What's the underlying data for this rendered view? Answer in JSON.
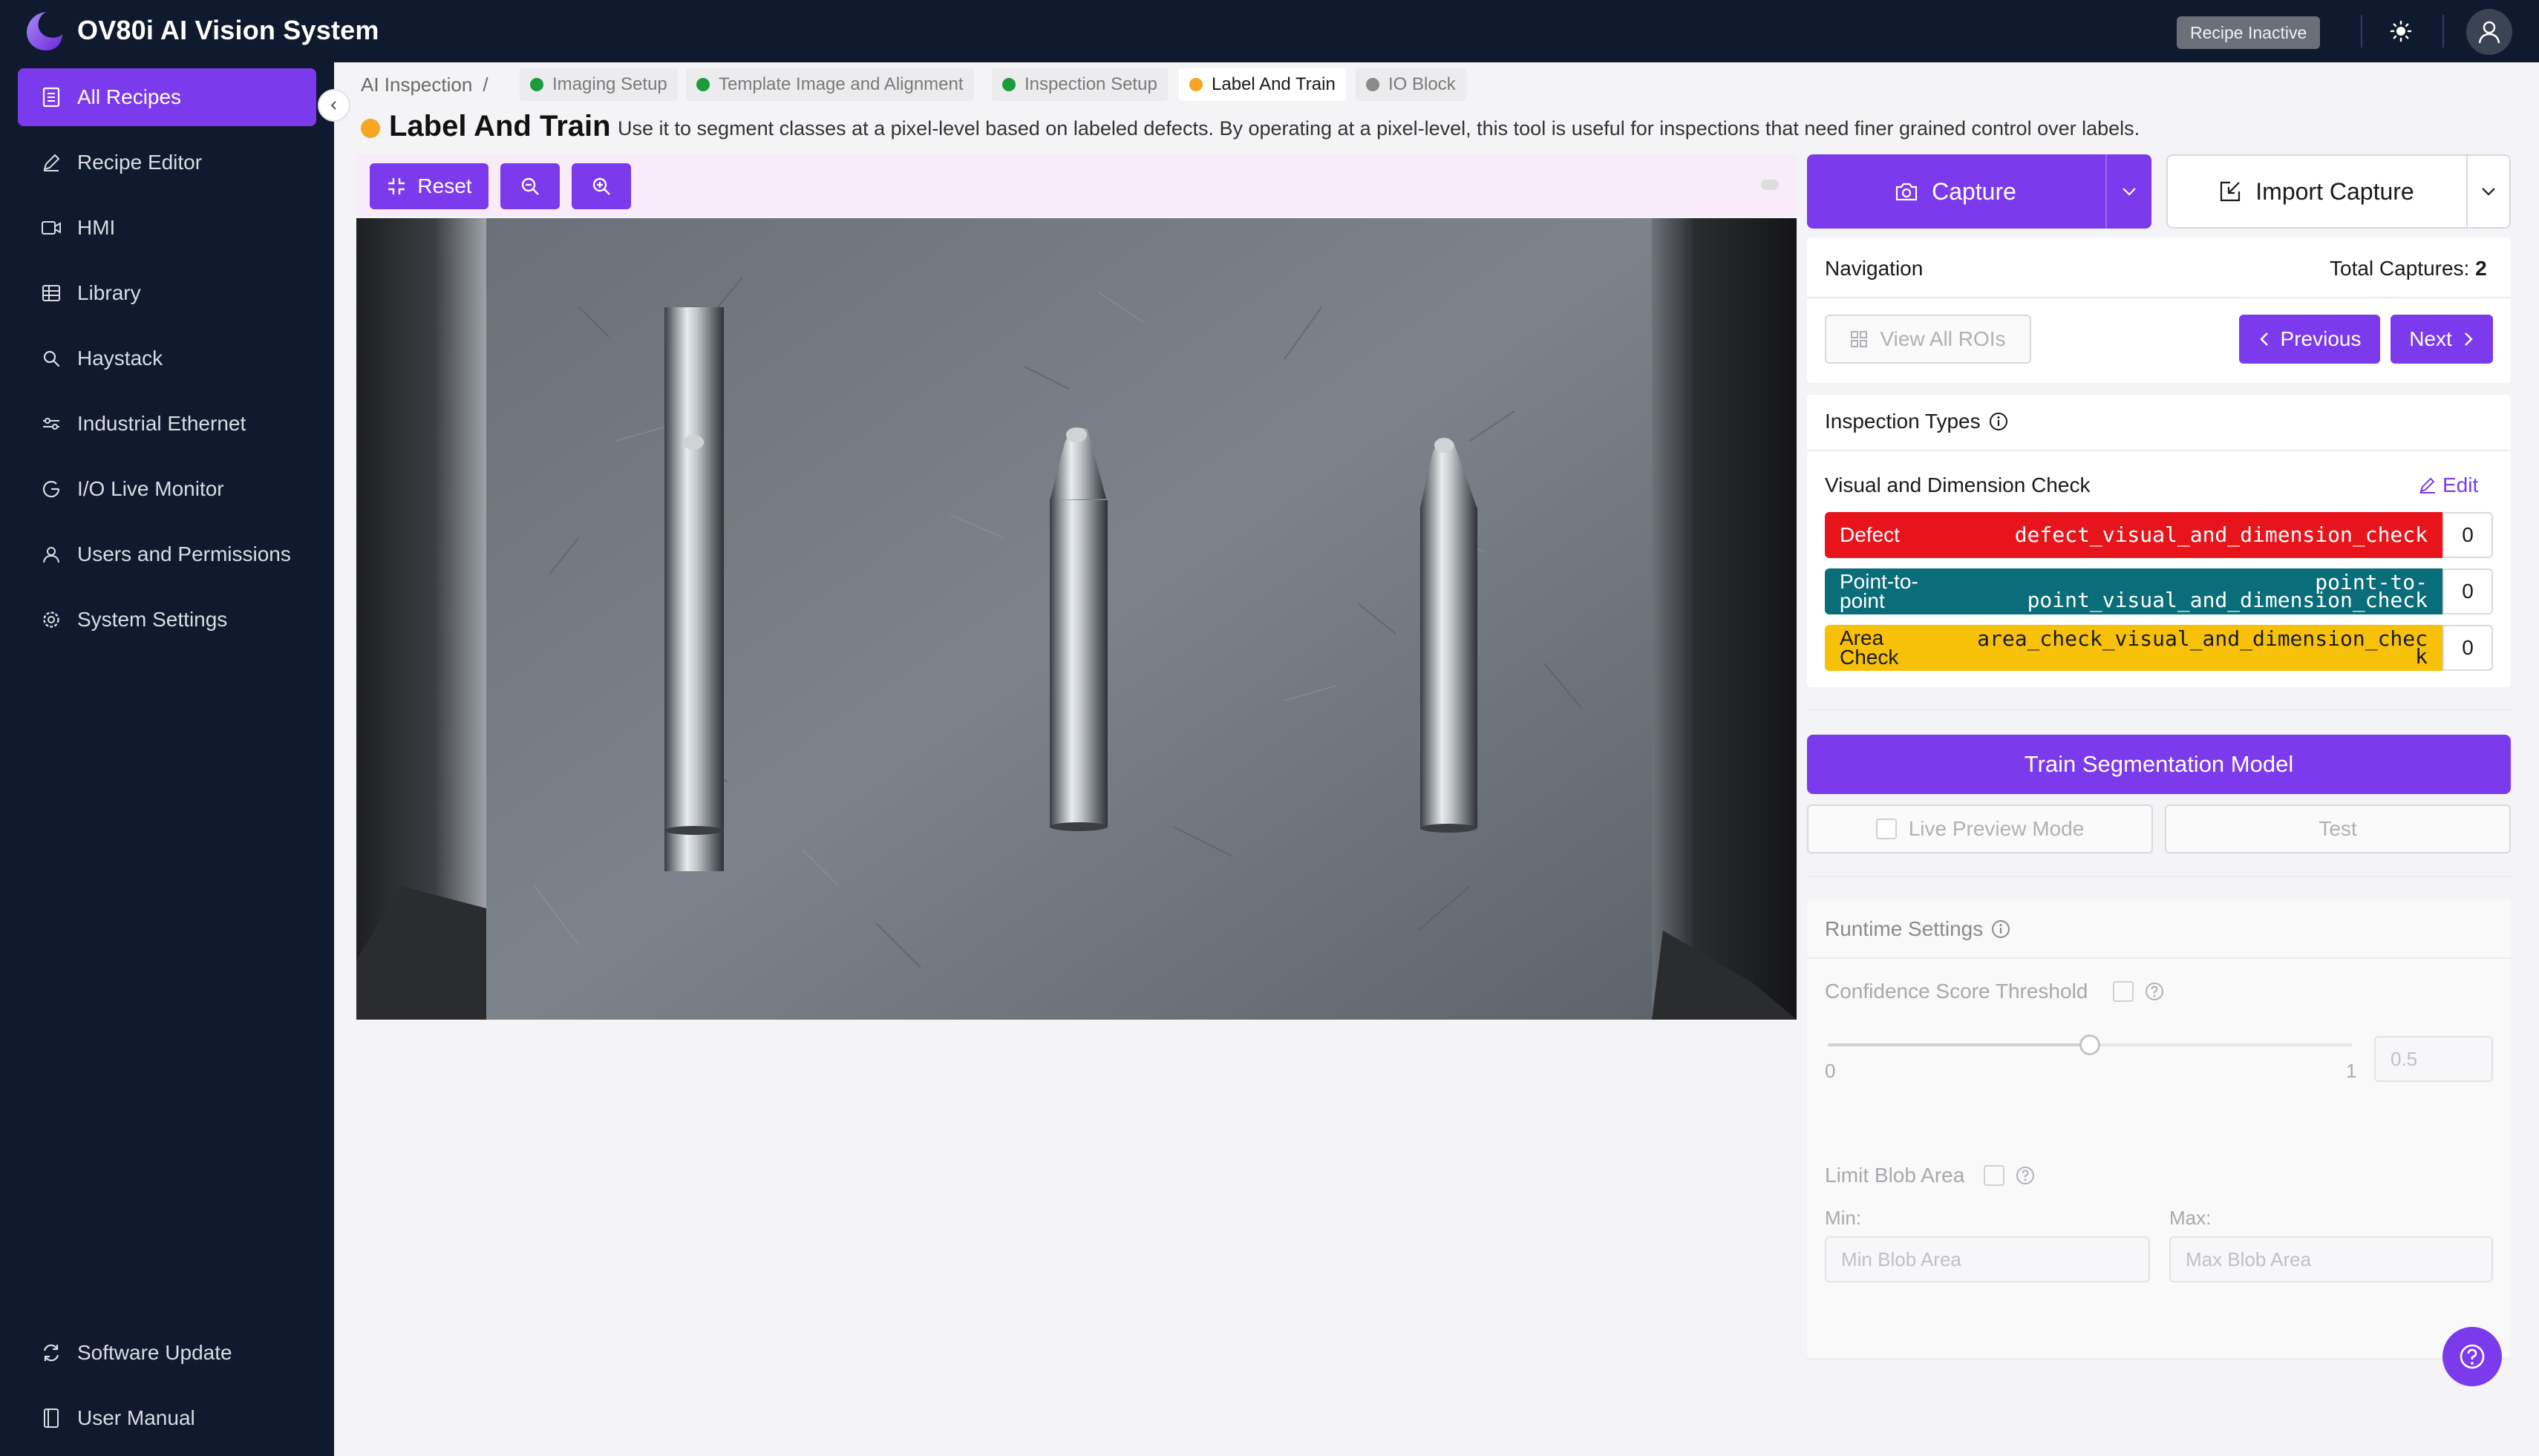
{
  "app": {
    "title": "OV80i AI Vision System",
    "recipe_status": "Recipe Inactive",
    "brand_color": "#7c3aed"
  },
  "sidebar": {
    "items": [
      {
        "label": "All Recipes",
        "icon": "document-list-icon",
        "active": true
      },
      {
        "label": "Recipe Editor",
        "icon": "pencil-icon"
      },
      {
        "label": "HMI",
        "icon": "video-icon"
      },
      {
        "label": "Library",
        "icon": "grid-icon"
      },
      {
        "label": "Haystack",
        "icon": "search-icon"
      },
      {
        "label": "Industrial Ethernet",
        "icon": "ethernet-icon"
      },
      {
        "label": "I/O Live Monitor",
        "icon": "monitor-icon"
      },
      {
        "label": "Users and Permissions",
        "icon": "user-icon"
      },
      {
        "label": "System Settings",
        "icon": "gear-icon"
      }
    ],
    "footer": [
      {
        "label": "Software Update",
        "icon": "refresh-icon"
      },
      {
        "label": "User Manual",
        "icon": "book-icon"
      }
    ]
  },
  "breadcrumb": {
    "root": "AI Inspection",
    "separator": "/",
    "steps": [
      {
        "label": "Imaging Setup",
        "color": "#1a9c3a"
      },
      {
        "label": "Template Image and Alignment",
        "color": "#1a9c3a"
      },
      {
        "label": "Inspection Setup",
        "color": "#1a9c3a"
      },
      {
        "label": "Label And Train",
        "color": "#f5a623",
        "active": true
      },
      {
        "label": "IO Block",
        "color": "#8a8a8a"
      }
    ]
  },
  "page": {
    "title": "Label And Train",
    "description": "Use it to segment classes at a pixel-level based on labeled defects. By operating at a pixel-level, this tool is useful for inspections that need finer grained control over labels."
  },
  "toolbar": {
    "reset_label": "Reset"
  },
  "capture": {
    "capture_label": "Capture",
    "import_label": "Import Capture"
  },
  "navigation": {
    "heading": "Navigation",
    "total_label": "Total Captures:",
    "total_value": "2",
    "view_all_label": "View All ROIs",
    "previous_label": "Previous",
    "next_label": "Next"
  },
  "inspection_types": {
    "heading": "Inspection Types",
    "group_name": "Visual and Dimension Check",
    "edit_label": "Edit",
    "classes": [
      {
        "name": "Defect",
        "id": "defect_visual_and_dimension_check",
        "count": "0",
        "color": "#e8141c",
        "text_color": "#ffffff"
      },
      {
        "name": "Point-to-point",
        "id": "point-to-point_visual_and_dimension_check",
        "count": "0",
        "color": "#0a6e7a",
        "text_color": "#ffffff"
      },
      {
        "name": "Area Check",
        "id": "area_check_visual_and_dimension_check",
        "count": "0",
        "color": "#f7c10a",
        "text_color": "#1a1a1a"
      }
    ]
  },
  "training": {
    "train_label": "Train Segmentation Model",
    "live_preview_label": "Live Preview Mode",
    "test_label": "Test"
  },
  "runtime": {
    "heading": "Runtime Settings",
    "confidence_label": "Confidence Score Threshold",
    "slider_min": "0",
    "slider_max": "1",
    "slider_value": 0.5,
    "threshold_placeholder": "0.5",
    "limit_blob_label": "Limit Blob Area",
    "min_label": "Min:",
    "max_label": "Max:",
    "min_placeholder": "Min Blob Area",
    "max_placeholder": "Max Blob Area"
  }
}
